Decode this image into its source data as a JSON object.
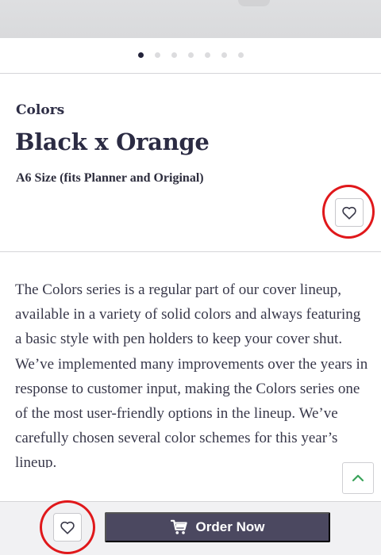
{
  "gallery": {
    "slide_count": 7,
    "active_index": 0
  },
  "product": {
    "series_label": "Colors",
    "title": "Black x Orange",
    "size_note": "A6 Size (fits Planner and Original)",
    "description": "The Colors series is a regular part of our cover lineup, available in a variety of solid colors and always featuring a basic style with pen holders to keep your cover shut. We’ve implemented many improvements over the years in response to customer input, making the Colors series one of the most user-friendly options in the lineup. We’ve carefully chosen several color schemes for this year’s lineup."
  },
  "icons": {
    "favorite": "heart-outline-icon",
    "cart": "cart-icon",
    "scroll_top": "chevron-up-icon"
  },
  "actions": {
    "order_label": "Order Now"
  },
  "colors": {
    "text_dark": "#2d2d45",
    "order_button": "#4b4860",
    "scroll_top_chevron": "#3aa35a",
    "annotation_ring": "#e0181b",
    "dot_active": "#23233a",
    "dot_inactive": "#dcdcde"
  }
}
